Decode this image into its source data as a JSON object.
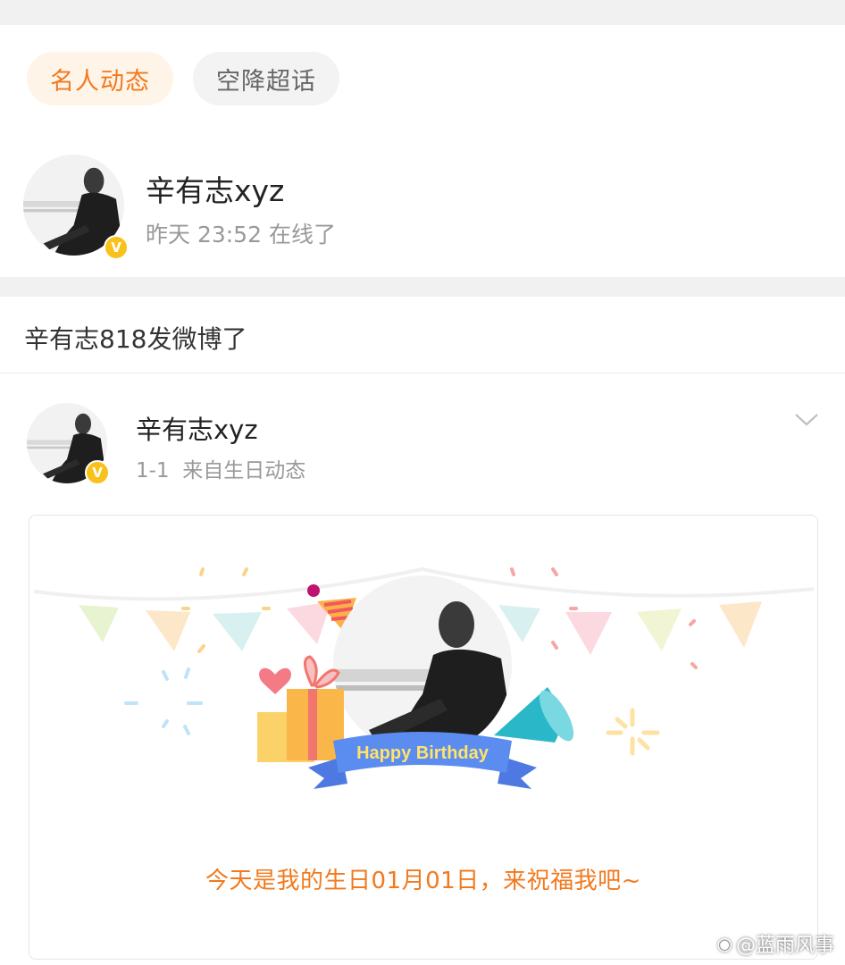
{
  "tabs": [
    {
      "label": "名人动态",
      "active": true
    },
    {
      "label": "空降超话",
      "active": false
    }
  ],
  "online_card": {
    "username": "辛有志xyz",
    "status": "昨天 23:52 在线了"
  },
  "section_header": "辛有志818发微博了",
  "post": {
    "username": "辛有志xyz",
    "meta": "1-1  来自生日动态",
    "banner_text": "Happy Birthday",
    "wish_text": "今天是我的生日01月01日，来祝福我吧~"
  },
  "watermark": "@蓝雨风事",
  "colors": {
    "accent": "#f2791e",
    "verified_badge": "#f8c21a",
    "ribbon": "#5b8cf0",
    "ribbon_text": "#ffe36b"
  },
  "icons": [
    "verified-badge-icon",
    "chevron-down-icon",
    "weibo-logo-icon"
  ]
}
